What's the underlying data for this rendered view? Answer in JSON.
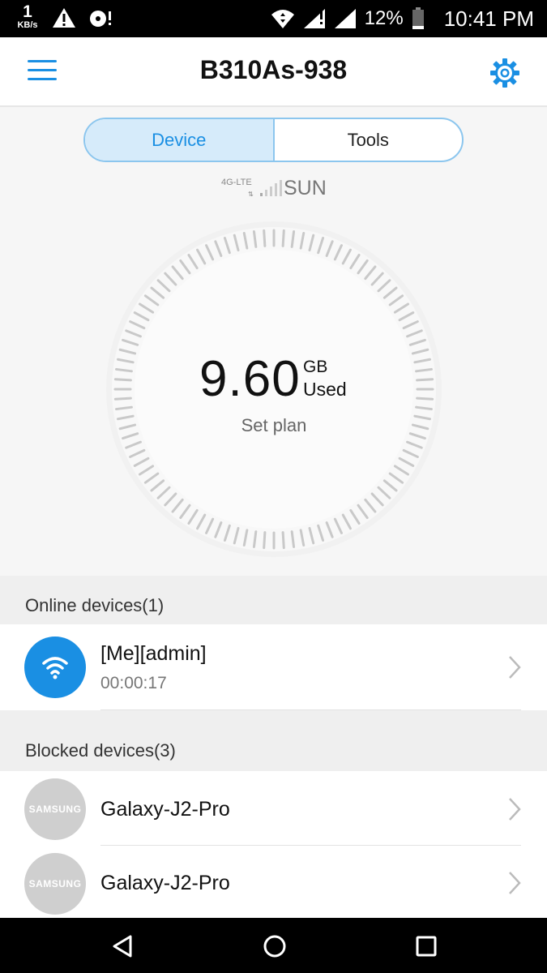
{
  "status_bar": {
    "speed_value": "1",
    "speed_unit": "KB/s",
    "battery_percent": "12%",
    "time": "10:41 PM",
    "icons": [
      "warning-icon",
      "cd-icon",
      "wifi-icon",
      "signal-icon",
      "battery-icon"
    ]
  },
  "header": {
    "title": "B310As-938",
    "menu_icon": "hamburger-menu-icon",
    "settings_icon": "gear-icon",
    "accent_color": "#1a8fe3"
  },
  "tabs": [
    {
      "label": "Device",
      "active": true
    },
    {
      "label": "Tools",
      "active": false
    }
  ],
  "network": {
    "technology": "4G-LTE",
    "carrier": "SUN"
  },
  "usage": {
    "value": "9.60",
    "unit": "GB",
    "label": "Used",
    "set_plan": "Set plan"
  },
  "online_section": {
    "title": "Online devices(1)",
    "devices": [
      {
        "name": "[Me][admin]",
        "duration": "00:00:17",
        "icon": "wifi-icon"
      }
    ]
  },
  "blocked_section": {
    "title": "Blocked devices(3)",
    "devices": [
      {
        "name": "Galaxy-J2-Pro",
        "brand": "SAMSUNG"
      },
      {
        "name": "Galaxy-J2-Pro",
        "brand": "SAMSUNG"
      }
    ]
  },
  "nav_bar": {
    "icons": [
      "back-icon",
      "home-icon",
      "recents-icon"
    ]
  }
}
